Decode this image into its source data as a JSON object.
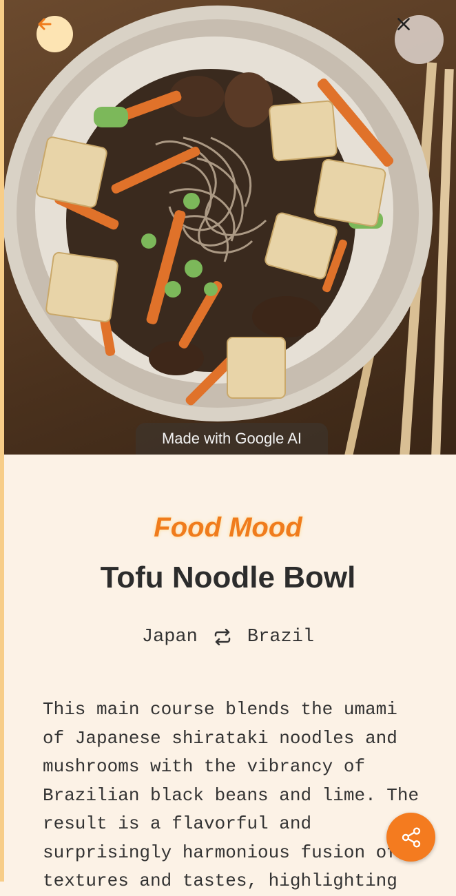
{
  "header": {
    "back_icon": "arrow-left-icon",
    "close_icon": "close-icon"
  },
  "hero": {
    "badge_text": "Made with Google AI"
  },
  "recipe": {
    "brand": "Food Mood",
    "title": "Tofu Noodle Bowl",
    "country_from": "Japan",
    "swap_icon": "swap-arrows-icon",
    "country_to": "Brazil",
    "description": "This main course blends the umami of Japanese shirataki noodles and mushrooms with the vibrancy of Brazilian black beans and lime. The result is a flavorful and surprisingly harmonious fusion of textures and tastes, highlighting"
  },
  "actions": {
    "share_icon": "share-icon"
  },
  "colors": {
    "accent": "#f47b1f",
    "background": "#fcf2e6",
    "back_button_bg": "#fde4b3",
    "text": "#2c2c2c"
  }
}
